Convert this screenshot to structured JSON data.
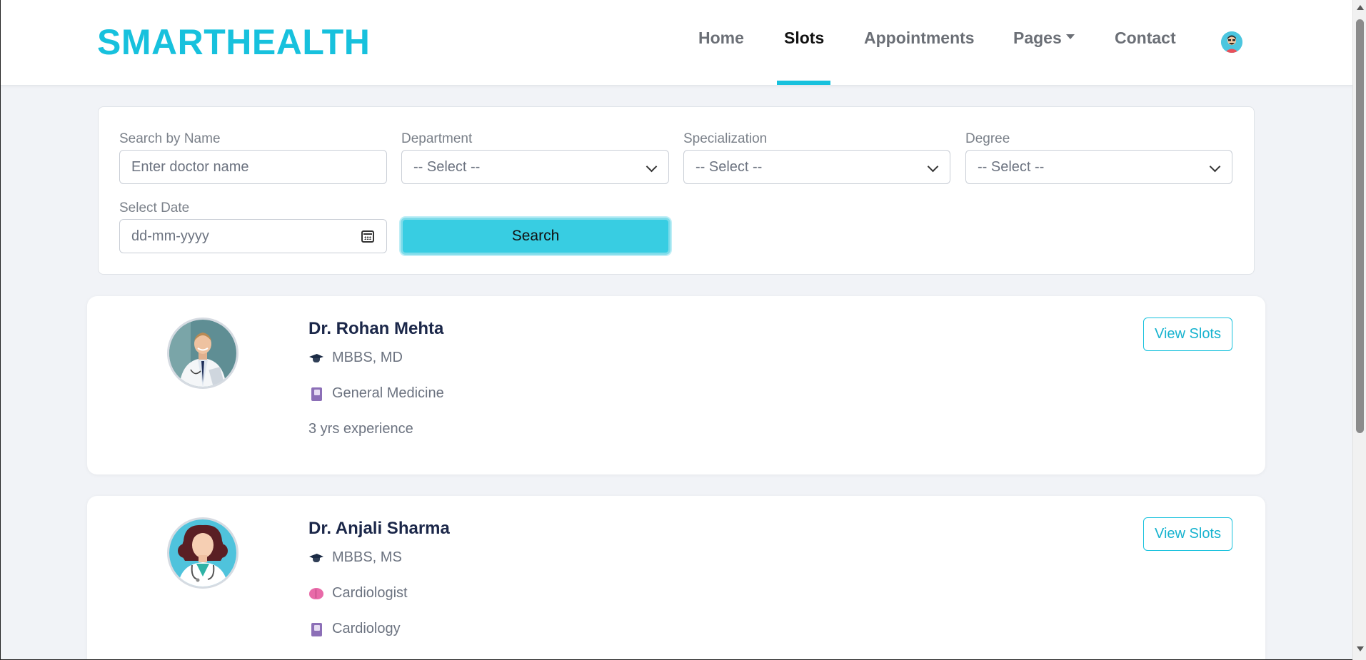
{
  "brand": {
    "name": "SMARTHEALTH",
    "color": "#17c1dd"
  },
  "nav": {
    "items": [
      {
        "label": "Home",
        "active": false
      },
      {
        "label": "Slots",
        "active": true
      },
      {
        "label": "Appointments",
        "active": false
      },
      {
        "label": "Pages",
        "active": false,
        "dropdown": true
      },
      {
        "label": "Contact",
        "active": false
      }
    ],
    "avatar_icon": "user-avatar-icon"
  },
  "search": {
    "name_label": "Search by Name",
    "name_placeholder": "Enter doctor name",
    "department_label": "Department",
    "department_value": "-- Select --",
    "specialization_label": "Specialization",
    "specialization_value": "-- Select --",
    "degree_label": "Degree",
    "degree_value": "-- Select --",
    "date_label": "Select Date",
    "date_placeholder": "dd-mm-yyyy",
    "button_label": "Search",
    "button_color": "#38cde2"
  },
  "doctors": [
    {
      "name": "Dr. Rohan Mehta",
      "degree": "MBBS, MD",
      "department": "General Medicine",
      "experience": "3 yrs experience",
      "action": "View Slots"
    },
    {
      "name": "Dr. Anjali Sharma",
      "degree": "MBBS, MS",
      "specialization": "Cardiologist",
      "department": "Cardiology",
      "action": "View Slots"
    }
  ]
}
